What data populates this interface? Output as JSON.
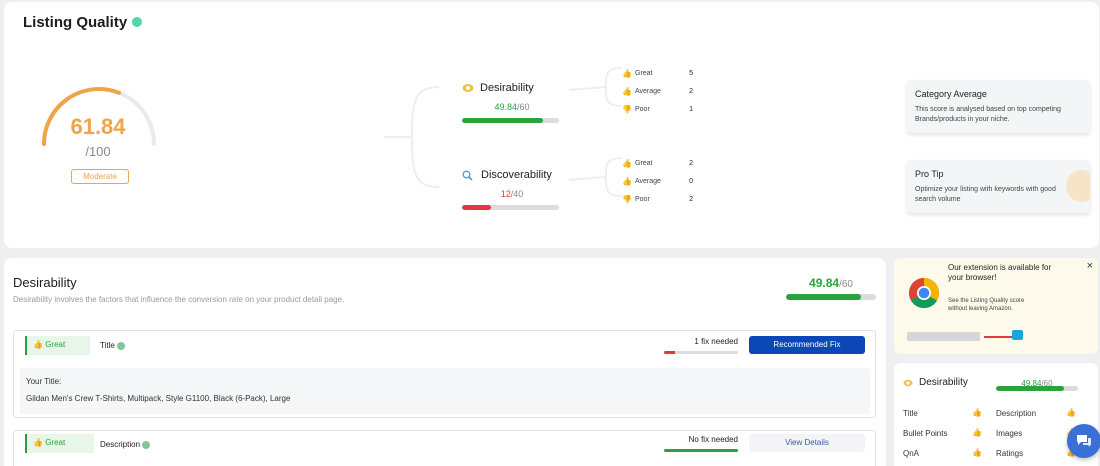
{
  "header": {
    "title": "Listing Quality"
  },
  "overall": {
    "score": "61.84",
    "out_of": "/100",
    "rating": "Moderate",
    "fraction": 0.6184
  },
  "metrics": [
    {
      "name": "Desirability",
      "score": "49.84",
      "max": "/60",
      "fraction": 0.83,
      "color": "#2aa23e",
      "counts": [
        {
          "label": "Great",
          "value": "5"
        },
        {
          "label": "Average",
          "value": "2"
        },
        {
          "label": "Poor",
          "value": "1"
        }
      ]
    },
    {
      "name": "Discoverability",
      "score": "12",
      "max": "/40",
      "fraction": 0.3,
      "color": "#e03a3a",
      "counts": [
        {
          "label": "Great",
          "value": "2"
        },
        {
          "label": "Average",
          "value": "0"
        },
        {
          "label": "Poor",
          "value": "2"
        }
      ]
    }
  ],
  "side": {
    "category_title": "Category Average",
    "category_text": "This score is analysed based on top competing Brands/products in your niche.",
    "tip_title": "Pro Tip",
    "tip_text": "Optimize your listing with keywords with good search volume"
  },
  "section": {
    "title": "Desirability",
    "subtitle": "Desirability involves the factors that influence the conversion rate on your product detail page.",
    "score": "49.84",
    "max": "/60",
    "fraction": 0.83
  },
  "rows": [
    {
      "status": "Great",
      "label": "Title",
      "fix": "1 fix needed",
      "button": "Recommended Fix",
      "detail_label": "Your Title:",
      "detail_value": "Gildan Men's Crew T-Shirts, Multipack, Style G1100, Black (6-Pack), Large"
    },
    {
      "status": "Great",
      "label": "Description",
      "fix": "No fix needed",
      "button": "View Details"
    }
  ],
  "promo": {
    "title": "Our extension is available for your browser!",
    "text": "See the Listing Quality score without leaving Amazon.",
    "close": "×"
  },
  "summary": {
    "title": "Desirability",
    "score": "49.84",
    "max": "/60",
    "fraction": 0.83,
    "items": [
      {
        "label": "Title",
        "status": "green"
      },
      {
        "label": "Description",
        "status": "green"
      },
      {
        "label": "Bullet Points",
        "status": "orange"
      },
      {
        "label": "Images",
        "status": "orange"
      },
      {
        "label": "QnA",
        "status": "orange"
      },
      {
        "label": "Ratings",
        "status": "orange"
      }
    ]
  },
  "icons": {
    "thumb": "thumbs-up-icon",
    "eye": "eye-icon",
    "search": "search-icon",
    "chrome": "chrome-logo",
    "chat": "chat-icon"
  }
}
